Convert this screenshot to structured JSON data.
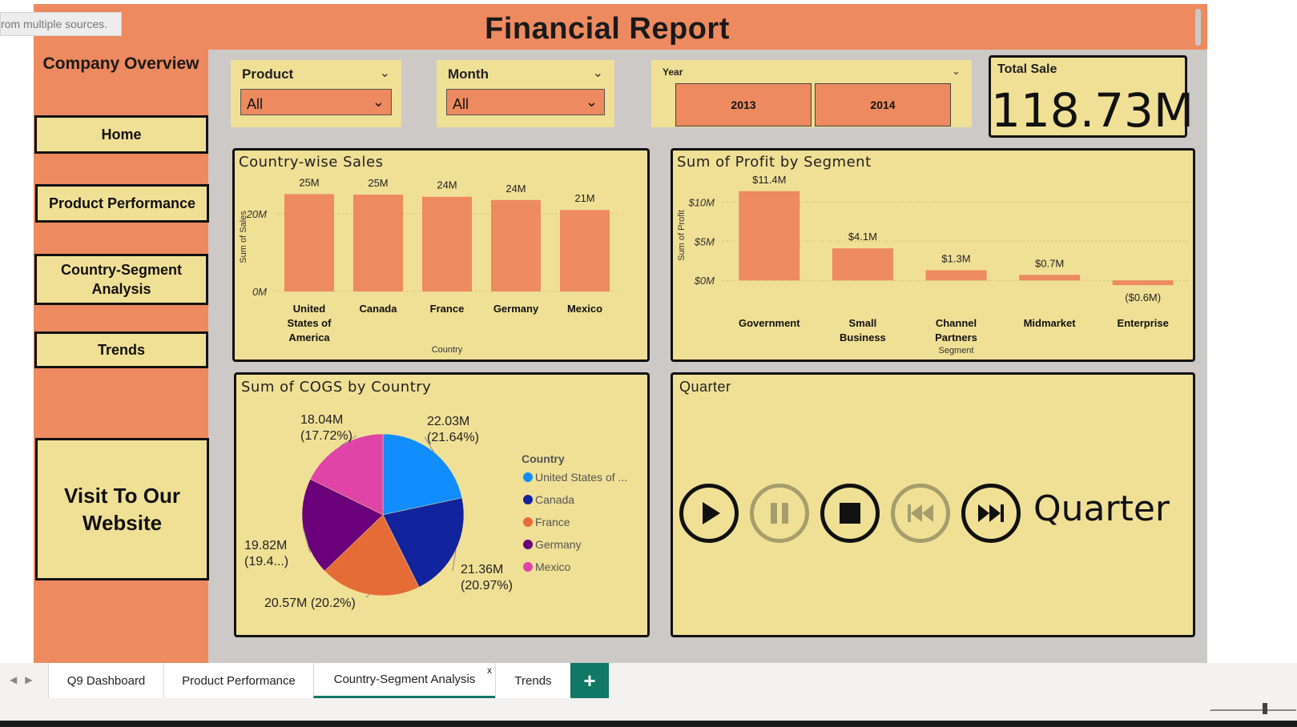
{
  "report": {
    "title": "Financial Report",
    "tooltip_fragment": "rom multiple sources."
  },
  "sidebar": {
    "title": "Company Overview",
    "buttons": {
      "home": "Home",
      "product": "Product Performance",
      "country_segment": "Country-Segment Analysis",
      "trends": "Trends",
      "website": "Visit To Our Website"
    }
  },
  "slicers": {
    "product": {
      "label": "Product",
      "value": "All"
    },
    "month": {
      "label": "Month",
      "value": "All"
    },
    "year": {
      "label": "Year",
      "options": [
        "2013",
        "2014"
      ]
    }
  },
  "card": {
    "label": "Total Sale",
    "value": "118.73M"
  },
  "quarter": {
    "title": "Quarter",
    "label": "Quarter"
  },
  "tabs": [
    "Q9 Dashboard",
    "Product Performance",
    "Country-Segment Analysis",
    "Trends"
  ],
  "tab_close": "x",
  "colors": {
    "accent": "#ed8a5f",
    "panel": "#f0e096",
    "tab_active": "#117865"
  },
  "chart_data": [
    {
      "type": "bar",
      "title": "Country-wise Sales",
      "xlabel": "Country",
      "ylabel": "Sum of Sales",
      "categories": [
        "United States of America",
        "Canada",
        "France",
        "Germany",
        "Mexico"
      ],
      "values": [
        25.03,
        24.89,
        24.35,
        23.51,
        20.95
      ],
      "data_labels": [
        "25M",
        "25M",
        "24M",
        "24M",
        "21M"
      ],
      "yticks": [
        "0M",
        "20M"
      ],
      "ylim": [
        0,
        28
      ]
    },
    {
      "type": "bar",
      "title": "Sum of Profit by Segment",
      "xlabel": "Segment",
      "ylabel": "Sum of Profit",
      "categories": [
        "Government",
        "Small Business",
        "Channel Partners",
        "Midmarket",
        "Enterprise"
      ],
      "values": [
        11.4,
        4.1,
        1.3,
        0.7,
        -0.6
      ],
      "data_labels": [
        "$11.4M",
        "$4.1M",
        "$1.3M",
        "$0.7M",
        "($0.6M)"
      ],
      "yticks": [
        "$0M",
        "$5M",
        "$10M"
      ],
      "ylim": [
        -1,
        12.5
      ]
    },
    {
      "type": "pie",
      "title": "Sum of COGS by Country",
      "legend_title": "Country",
      "legend": [
        "United States of ...",
        "Canada",
        "France",
        "Germany",
        "Mexico"
      ],
      "values": [
        22.03,
        21.36,
        20.57,
        19.82,
        18.04
      ],
      "data_labels": [
        "22.03M\n(21.64%)",
        "21.36M\n(20.97%)",
        "20.57M (20.2%)",
        "19.82M\n(19.4...)",
        "18.04M\n(17.72%)"
      ],
      "colors": [
        "#118dff",
        "#12239e",
        "#e66c37",
        "#6b007b",
        "#e044a7"
      ]
    }
  ]
}
